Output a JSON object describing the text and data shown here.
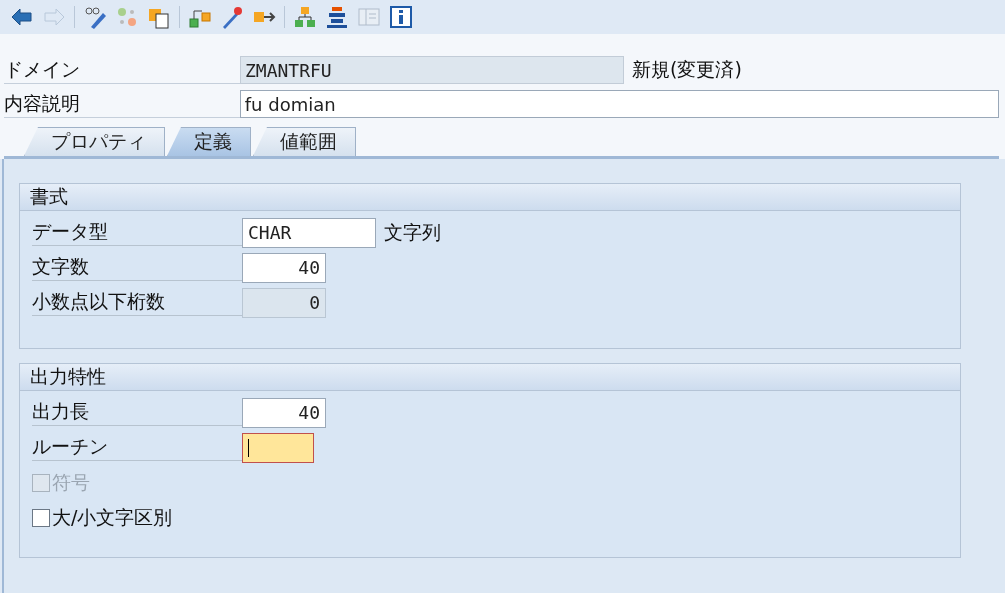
{
  "toolbar": [
    {
      "kind": "back",
      "disabled": false
    },
    {
      "kind": "forward",
      "disabled": true
    },
    {
      "kind": "sep"
    },
    {
      "kind": "edit",
      "disabled": false
    },
    {
      "kind": "other",
      "disabled": false
    },
    {
      "kind": "copy",
      "disabled": false
    },
    {
      "kind": "sep"
    },
    {
      "kind": "where",
      "disabled": false
    },
    {
      "kind": "activate",
      "disabled": false
    },
    {
      "kind": "navigate",
      "disabled": false
    },
    {
      "kind": "sep"
    },
    {
      "kind": "hierarchy",
      "disabled": false
    },
    {
      "kind": "stack",
      "disabled": false
    },
    {
      "kind": "layout",
      "disabled": true
    },
    {
      "kind": "info",
      "disabled": false
    }
  ],
  "header": [
    {
      "label": "ドメイン",
      "value": "ZMANTRFU",
      "readonly": true,
      "status": "新規(変更済)"
    },
    {
      "label": "内容説明",
      "value": "fu domian",
      "readonly": false
    }
  ],
  "tabs": [
    {
      "label": "プロパティ",
      "selected": false
    },
    {
      "label": "定義",
      "selected": true
    },
    {
      "label": "値範囲",
      "selected": false
    }
  ],
  "groups": [
    {
      "title": "書式",
      "rows": [
        {
          "kind": "text",
          "label": "データ型",
          "value": "CHAR",
          "readonly": false,
          "suffix": "文字列"
        },
        {
          "kind": "number",
          "label": "文字数",
          "value": "40",
          "readonly": false
        },
        {
          "kind": "number",
          "label": "小数点以下桁数",
          "value": "0",
          "readonly": true
        }
      ]
    },
    {
      "title": "出力特性",
      "rows": [
        {
          "kind": "number",
          "label": "出力長",
          "value": "40",
          "readonly": false
        },
        {
          "kind": "text",
          "label": "ルーチン",
          "value": "",
          "readonly": false,
          "focused": true
        },
        {
          "kind": "checkbox",
          "label": "符号",
          "checked": false,
          "disabled": true
        },
        {
          "kind": "checkbox",
          "label": "大/小文字区別",
          "checked": false,
          "disabled": false
        }
      ]
    }
  ]
}
